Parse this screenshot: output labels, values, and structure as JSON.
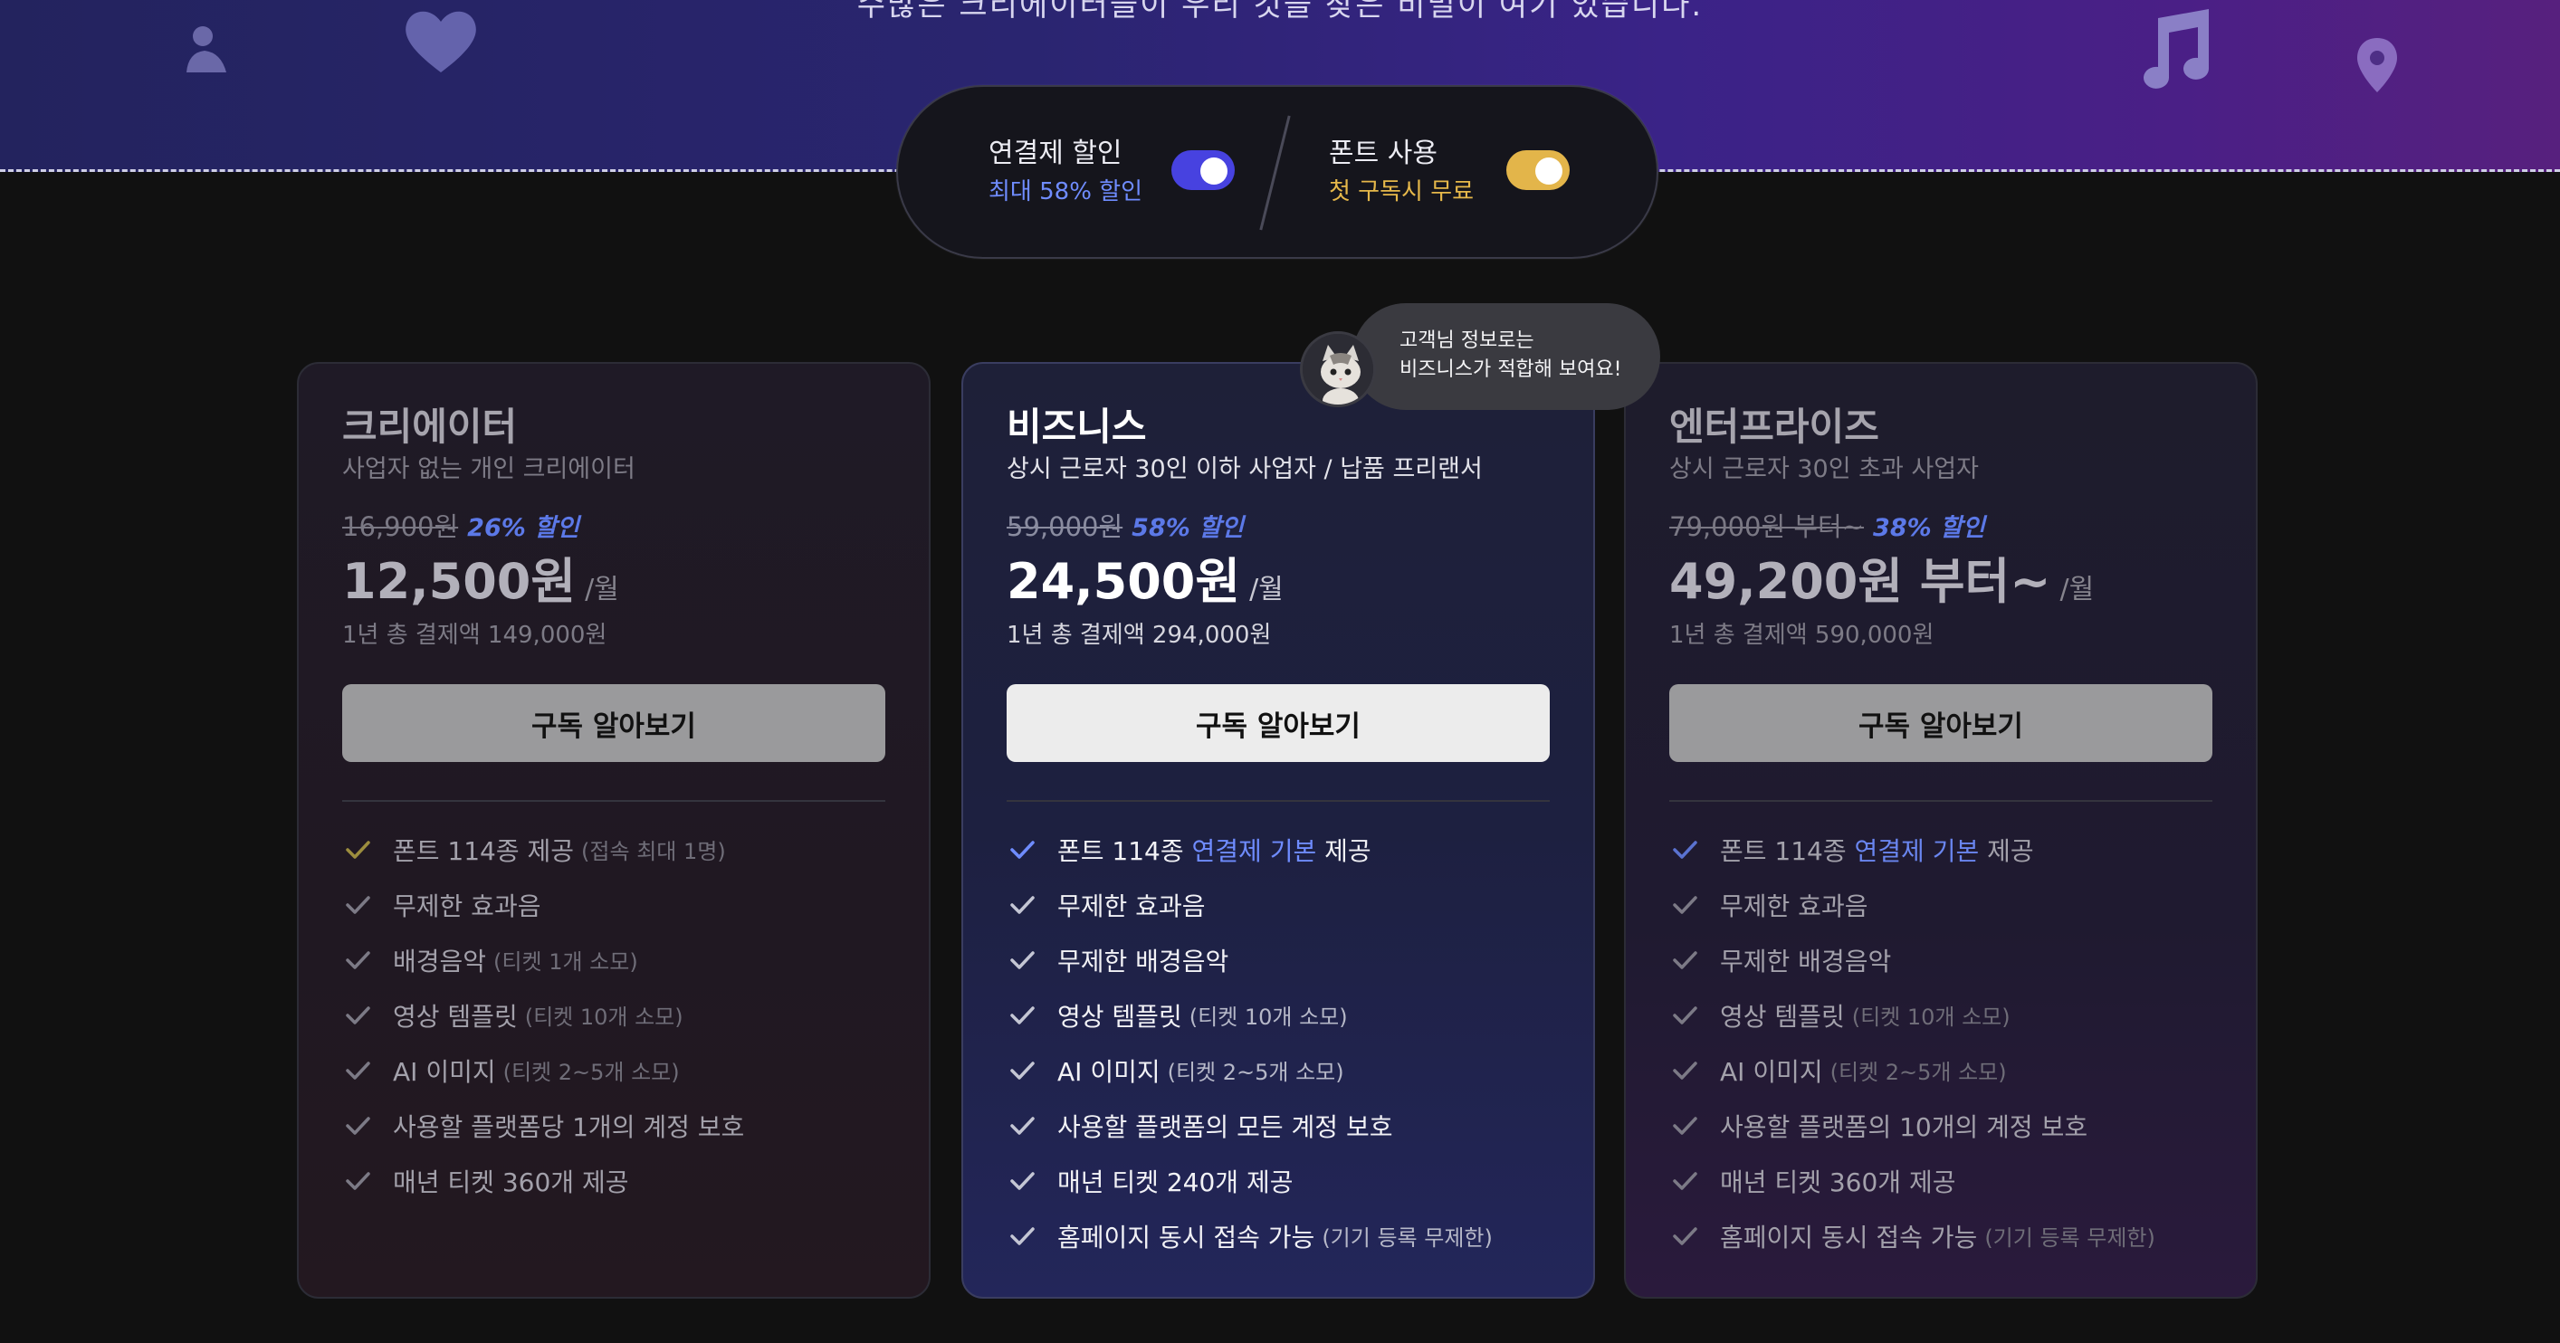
{
  "banner": {
    "partial_text": "수많은 크리에이터들이 우리 것을 찾은 비밀이 여기 있습니다."
  },
  "toggles": [
    {
      "label": "연결제 할인",
      "sub": "최대 58% 할인",
      "on": true,
      "color": "#4742e0"
    },
    {
      "label": "폰트 사용",
      "sub": "첫 구독시 무료",
      "on": true,
      "color": "#e3b54a"
    }
  ],
  "tooltip": {
    "line1": "고객님 정보로는",
    "line2": "비즈니스가 적합해 보여요!"
  },
  "plans": [
    {
      "name": "크리에이터",
      "desc": "사업자 없는 개인 크리에이터",
      "orig_price": "16,900원",
      "discount": "26% 할인",
      "price": "12,500원",
      "unit": "/월",
      "yearly": "1년 총 결제액 149,000원",
      "cta": "구독 알아보기",
      "features": [
        {
          "text": "폰트 114종 제공",
          "note": "(접속 최대 1명)"
        },
        {
          "text": "무제한 효과음",
          "note": ""
        },
        {
          "text": "배경음악",
          "note": "(티켓 1개 소모)"
        },
        {
          "text": "영상 템플릿",
          "note": "(티켓 10개 소모)"
        },
        {
          "text": "AI 이미지",
          "note": "(티켓 2~5개 소모)"
        },
        {
          "text": "사용할 플랫폼당 1개의 계정 보호",
          "note": ""
        },
        {
          "text": "매년 티켓 360개 제공",
          "note": ""
        }
      ]
    },
    {
      "name": "비즈니스",
      "desc": "상시 근로자 30인 이하 사업자 / 납품 프리랜서",
      "orig_price": "59,000원",
      "discount": "58% 할인",
      "price": "24,500원",
      "unit": "/월",
      "yearly": "1년 총 결제액 294,000원",
      "cta": "구독 알아보기",
      "features": [
        {
          "pre": "폰트 114종 ",
          "hl": "연결제 기본",
          "post": " 제공"
        },
        {
          "text": "무제한 효과음",
          "note": ""
        },
        {
          "text": "무제한 배경음악",
          "note": ""
        },
        {
          "text": "영상 템플릿",
          "note": "(티켓 10개 소모)"
        },
        {
          "text": "AI 이미지",
          "note": "(티켓 2~5개 소모)"
        },
        {
          "text": "사용할 플랫폼의 모든 계정 보호",
          "note": ""
        },
        {
          "text": "매년 티켓 240개 제공",
          "note": ""
        },
        {
          "text": "홈페이지 동시 접속 가능",
          "note": "(기기 등록 무제한)"
        }
      ]
    },
    {
      "name": "엔터프라이즈",
      "desc": "상시 근로자 30인 초과 사업자",
      "orig_price": "79,000원 부터~",
      "discount": "38% 할인",
      "price": "49,200원 부터~",
      "unit": "/월",
      "yearly": "1년 총 결제액 590,000원",
      "cta": "구독 알아보기",
      "features": [
        {
          "pre": "폰트 114종 ",
          "hl": "연결제 기본",
          "post": " 제공"
        },
        {
          "text": "무제한 효과음",
          "note": ""
        },
        {
          "text": "무제한 배경음악",
          "note": ""
        },
        {
          "text": "영상 템플릿",
          "note": "(티켓 10개 소모)"
        },
        {
          "text": "AI 이미지",
          "note": "(티켓 2~5개 소모)"
        },
        {
          "text": "사용할 플랫폼의 10개의 계정 보호",
          "note": ""
        },
        {
          "text": "매년 티켓 360개 제공",
          "note": ""
        },
        {
          "text": "홈페이지 동시 접속 가능",
          "note": "(기기 등록 무제한)"
        }
      ]
    }
  ],
  "colors": {
    "accent_blue": "#6f8cff",
    "accent_gold": "#e6b84a",
    "check_gold": "#b8a24a",
    "check_blue": "#6f8cff",
    "check_grey": "#8a8894"
  },
  "icons": [
    "person-icon",
    "heart-icon",
    "music-note-icon",
    "location-pin-icon",
    "check-icon",
    "cat-avatar-icon"
  ]
}
